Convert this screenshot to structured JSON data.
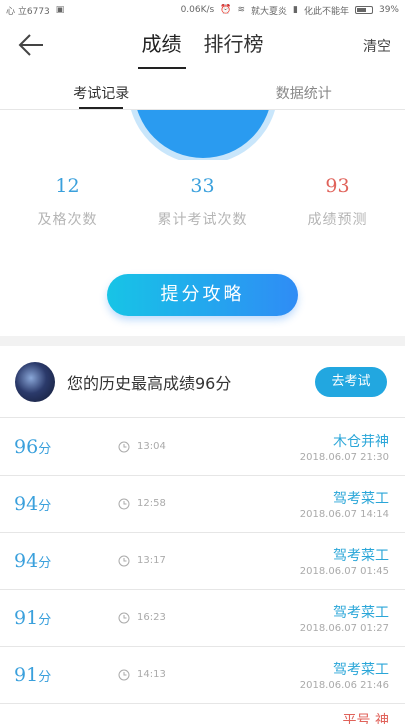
{
  "status_bar": {
    "left_text": "心 立6773",
    "network_speed": "0.06K/s",
    "carrier_1": "就大夏炎",
    "carrier_2": "化此不能年",
    "battery": "39%"
  },
  "nav": {
    "tabs": [
      {
        "label": "成绩"
      },
      {
        "label": "排行榜"
      }
    ],
    "clear_label": "清空"
  },
  "sub_tabs": [
    {
      "label": "考试记录"
    },
    {
      "label": "数据统计"
    }
  ],
  "stats": [
    {
      "value": "12",
      "label": "及格次数"
    },
    {
      "value": "33",
      "label": "累计考试次数"
    },
    {
      "value": "93",
      "label": "成绩预测"
    }
  ],
  "boost_button": "提分攻略",
  "best": {
    "text": "您的历史最高成绩96分",
    "button": "去考试"
  },
  "records": [
    {
      "score": "96",
      "unit": "分",
      "duration": "13:04",
      "name": "木仓茾神",
      "date": "2018.06.07 21:30"
    },
    {
      "score": "94",
      "unit": "分",
      "duration": "12:58",
      "name": "驾考菜工",
      "date": "2018.06.07 14:14"
    },
    {
      "score": "94",
      "unit": "分",
      "duration": "13:17",
      "name": "驾考菜工",
      "date": "2018.06.07 01:45"
    },
    {
      "score": "91",
      "unit": "分",
      "duration": "16:23",
      "name": "驾考菜工",
      "date": "2018.06.07 01:27"
    },
    {
      "score": "91",
      "unit": "分",
      "duration": "14:13",
      "name": "驾考菜工",
      "date": "2018.06.06 21:46"
    },
    {
      "name": "平号 神"
    }
  ],
  "colors": {
    "accent_blue": "#3aa0dc",
    "accent_red": "#e0625a",
    "button_gradient_start": "#17c4e6",
    "button_gradient_end": "#2f8cf5"
  }
}
